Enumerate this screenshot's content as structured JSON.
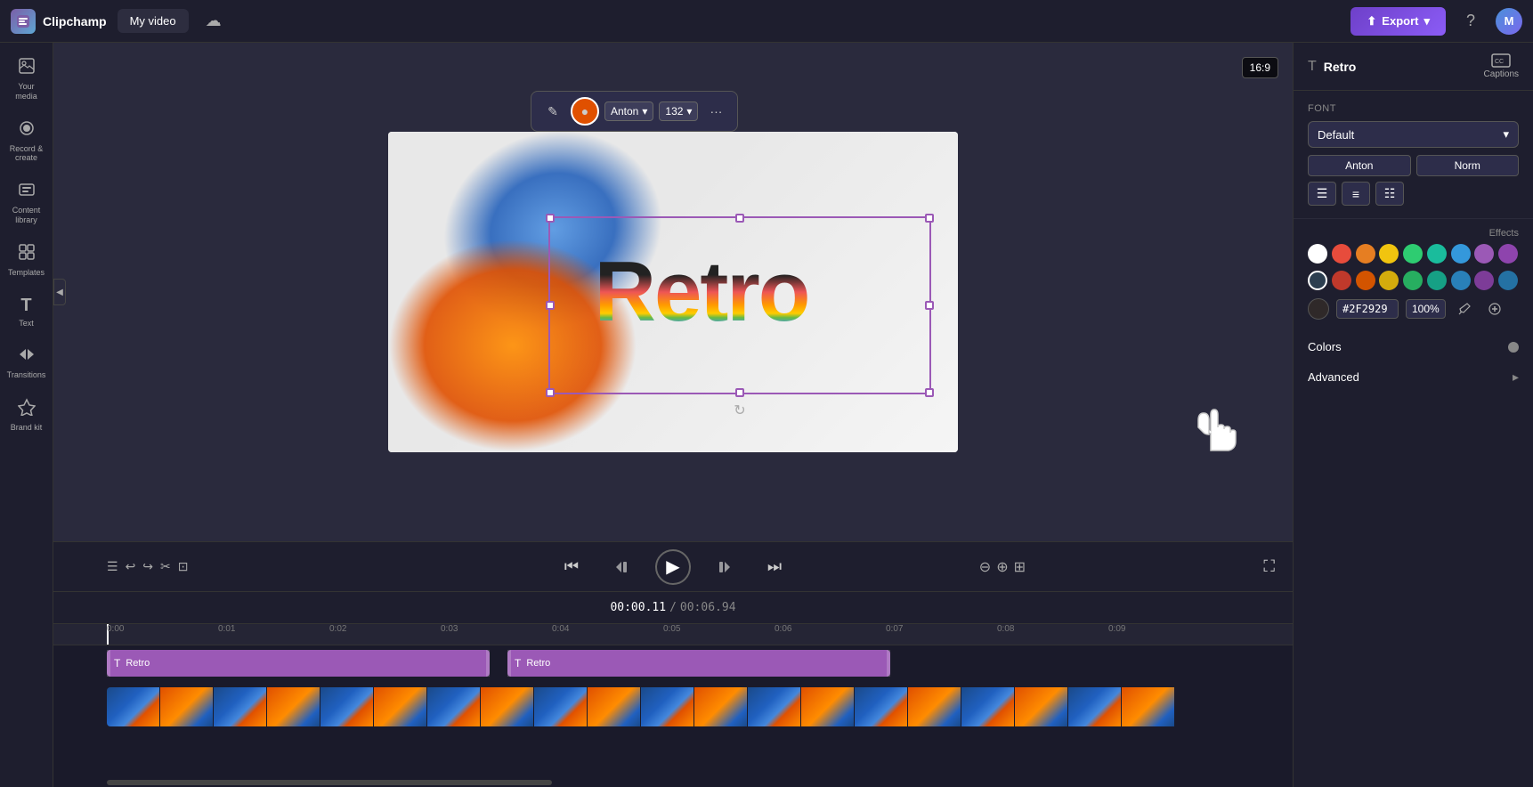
{
  "app": {
    "name": "Clipchamp",
    "tab": "My video"
  },
  "topbar": {
    "logo_text": "Clipchamp",
    "tab_label": "My video",
    "export_label": "Export",
    "help_label": "?",
    "avatar_label": "M"
  },
  "sidebar": {
    "items": [
      {
        "id": "your-media",
        "icon": "▣",
        "label": "Your media"
      },
      {
        "id": "record-create",
        "icon": "⏺",
        "label": "Record &\ncreate"
      },
      {
        "id": "content-library",
        "icon": "⊞",
        "label": "Content\nlibrary"
      },
      {
        "id": "templates",
        "icon": "⊠",
        "label": "Templates"
      },
      {
        "id": "text",
        "icon": "T",
        "label": "Text"
      },
      {
        "id": "transitions",
        "icon": "⇄",
        "label": "Transitions"
      },
      {
        "id": "brand-kit",
        "icon": "⬡",
        "label": "Brand kit"
      }
    ]
  },
  "canvas": {
    "aspect_ratio": "16:9",
    "text_content": "Retro"
  },
  "text_toolbar": {
    "edit_icon": "✎",
    "color_icon": "●",
    "font_label": "Anton",
    "size_label": "132",
    "more_icon": "···"
  },
  "right_panel": {
    "title": "Retro",
    "captions_label": "Captions",
    "font_section": {
      "label": "Font",
      "dropdown_value": "Default",
      "font_name": "Anton",
      "style_normal": "Norm",
      "align_left": "≡"
    },
    "color_swatches_row1": [
      {
        "color": "#ffffff",
        "label": "white"
      },
      {
        "color": "#e74c3c",
        "label": "red"
      },
      {
        "color": "#e67e22",
        "label": "orange"
      },
      {
        "color": "#f1c40f",
        "label": "yellow"
      },
      {
        "color": "#2ecc71",
        "label": "green"
      },
      {
        "color": "#1abc9c",
        "label": "teal"
      },
      {
        "color": "#3498db",
        "label": "blue"
      },
      {
        "color": "#9b59b6",
        "label": "purple"
      },
      {
        "color": "#8e44ad",
        "label": "dark-purple"
      }
    ],
    "color_swatches_row2": [
      {
        "color": "#2c3e50",
        "label": "dark"
      },
      {
        "color": "#c0392b",
        "label": "dark-red"
      },
      {
        "color": "#d35400",
        "label": "dark-orange"
      },
      {
        "color": "#d4ac0d",
        "label": "dark-yellow"
      },
      {
        "color": "#27ae60",
        "label": "dark-green"
      },
      {
        "color": "#16a085",
        "label": "dark-teal"
      },
      {
        "color": "#2980b9",
        "label": "dark-blue"
      },
      {
        "color": "#7d3c98",
        "label": "dark-purple2"
      },
      {
        "color": "#2471a3",
        "label": "navy"
      }
    ],
    "hex_value": "#2F2929",
    "opacity_value": "100%",
    "effects_label": "Effects",
    "colors_section_label": "Colors",
    "advanced_label": "Advanced"
  },
  "playback": {
    "time_current": "00:00.11",
    "time_total": "00:06.94",
    "time_separator": "/"
  },
  "timeline": {
    "tracks": [
      {
        "label": "Retro",
        "type": "text"
      },
      {
        "label": "Retro",
        "type": "text"
      }
    ]
  }
}
